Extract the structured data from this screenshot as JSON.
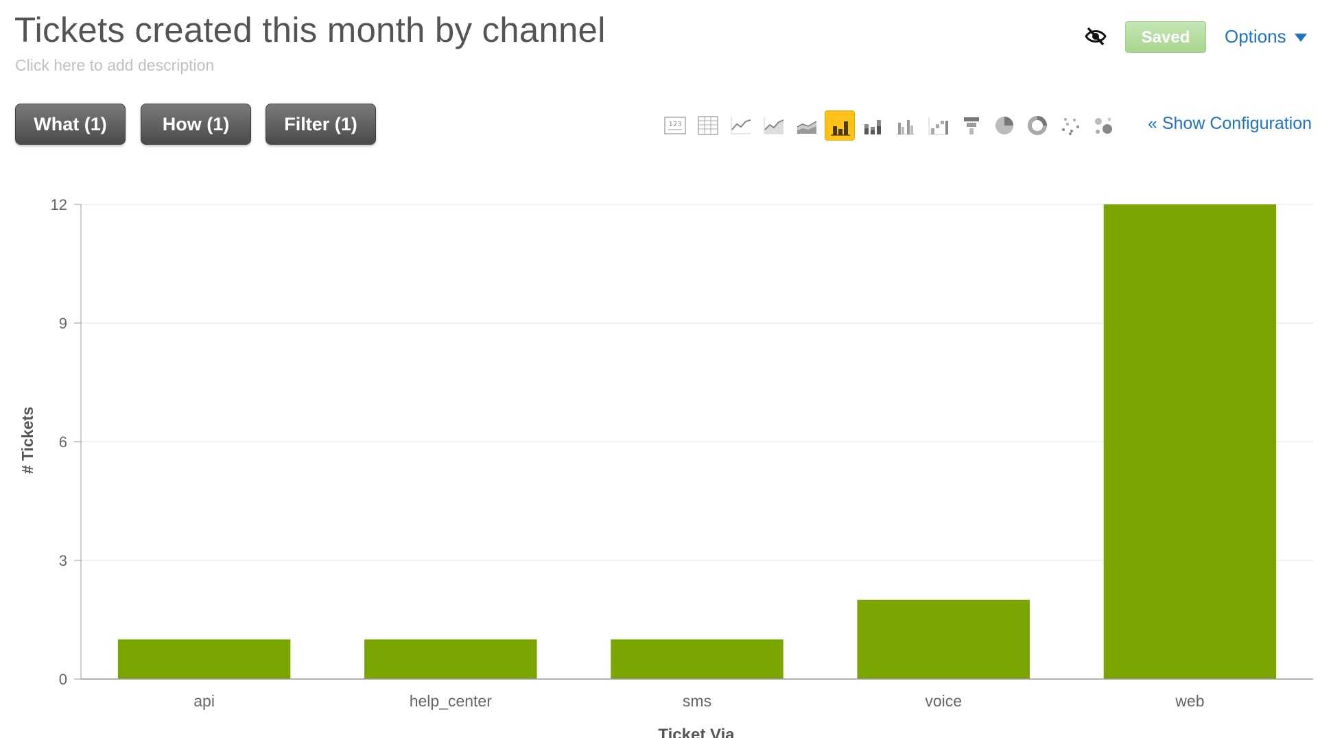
{
  "header": {
    "title": "Tickets created this month by channel",
    "description_placeholder": "Click here to add description",
    "saved_label": "Saved",
    "options_label": "Options"
  },
  "toolbar": {
    "what_label": "What (1)",
    "how_label": "How (1)",
    "filter_label": "Filter (1)",
    "show_config_label": "« Show Configuration",
    "viz_types": [
      "kpi-icon",
      "table-icon",
      "line-chart-icon",
      "line-area-icon",
      "stacked-area-icon",
      "column-chart-icon",
      "stacked-column-icon",
      "grouped-column-icon",
      "waterfall-icon",
      "funnel-icon",
      "pie-chart-icon",
      "donut-chart-icon",
      "scatter-icon",
      "bubble-icon"
    ],
    "active_viz": "column-chart-icon"
  },
  "colors": {
    "bar": "#7aa400",
    "accent": "#1f73c7",
    "active_viz": "#ffc21a"
  },
  "chart_data": {
    "type": "bar",
    "categories": [
      "api",
      "help_center",
      "sms",
      "voice",
      "web"
    ],
    "values": [
      1,
      1,
      1,
      2,
      12
    ],
    "xlabel": "Ticket Via",
    "ylabel": "# Tickets",
    "ylim": [
      0,
      12
    ],
    "yticks": [
      0,
      3,
      6,
      9,
      12
    ],
    "grid": true,
    "legend": "none"
  }
}
